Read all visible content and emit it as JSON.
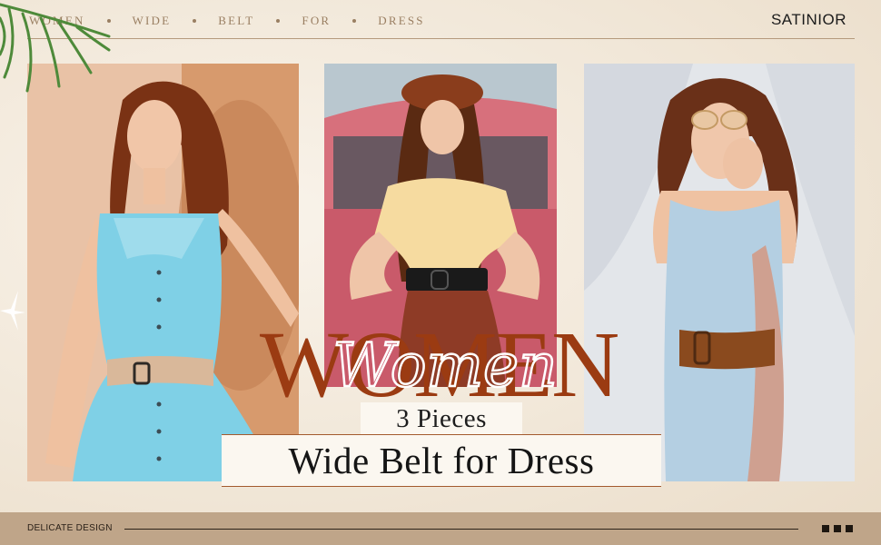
{
  "header": {
    "nav_words": [
      "WOMEN",
      "WIDE",
      "BELT",
      "FOR",
      "DRESS"
    ],
    "brand": "SATINIOR"
  },
  "hero": {
    "title": "WOMEN",
    "script_title": "Women",
    "pieces": "3 Pieces",
    "product": "Wide Belt for Dress"
  },
  "footer": {
    "label": "DELICATE DESIGN"
  },
  "colors": {
    "accent_rust": "#9b3b12",
    "accent_tan": "#bfa589",
    "belt_beige": "#d9b89a",
    "belt_black": "#1a1a1a",
    "belt_brown": "#8a4a1e"
  },
  "images": [
    {
      "name": "model-blue-dress-beige-belt"
    },
    {
      "name": "model-beret-black-belt"
    },
    {
      "name": "model-sunglasses-brown-belt"
    }
  ]
}
